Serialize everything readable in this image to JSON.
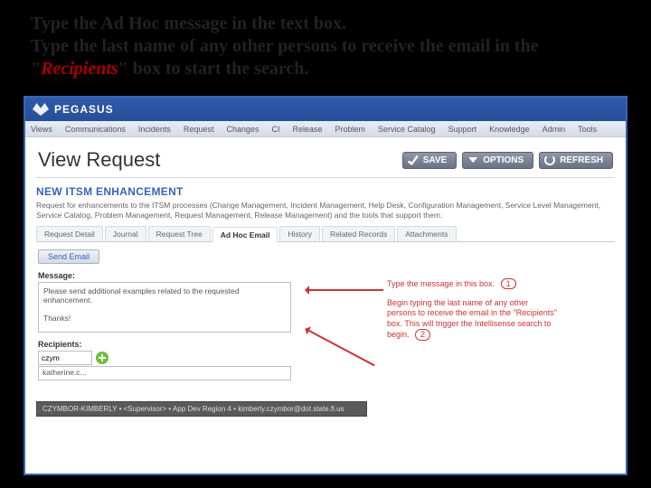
{
  "instructions": {
    "line1": "Type the Ad Hoc message in the text box.",
    "line2a": "Type the last name of any other persons to receive the email in the \"",
    "recipients_word": "Recipients",
    "line2b": "\" box to start the search."
  },
  "app": {
    "brand": "PEGASUS",
    "menu": [
      "Views",
      "Communications",
      "Incidents",
      "Request",
      "Changes",
      "CI",
      "Release",
      "Problem",
      "Service Catalog",
      "Support",
      "Knowledge",
      "Admin",
      "Tools"
    ],
    "page_title": "View Request",
    "buttons": {
      "save": "SAVE",
      "options": "OPTIONS",
      "refresh": "REFRESH"
    },
    "section_title": "NEW ITSM ENHANCEMENT",
    "section_desc": "Request for enhancements to the ITSM processes (Change Management, Incident Management, Help Desk, Configuration Management, Service Level Management, Service Catalog, Problem Management, Request Management, Release Management) and the tools that support them.",
    "tabs": [
      "Request Detail",
      "Journal",
      "Request Tree",
      "Ad Hoc Email",
      "History",
      "Related Records",
      "Attachments"
    ],
    "send_label": "Send Email",
    "message_label": "Message:",
    "message_value": "Please send additional examples related to the requested enhancement.\n\nThanks!",
    "recipients_label": "Recipients:",
    "recipients_value": "czym",
    "recipient_selected": "katherine.c...",
    "suggestion": "CZYMBOR-KIMBERLY • <Supervisor> • App Dev Region 4 • kimberly.czymbor@dot.state.fl.us"
  },
  "callouts": {
    "c1": "Type the message in this box.",
    "n1": "1",
    "c2": "Begin typing the last name of any other persons to receive the email in the \"Recipients\" box. This will trigger the Intellisense search to begin.",
    "n2": "2"
  }
}
